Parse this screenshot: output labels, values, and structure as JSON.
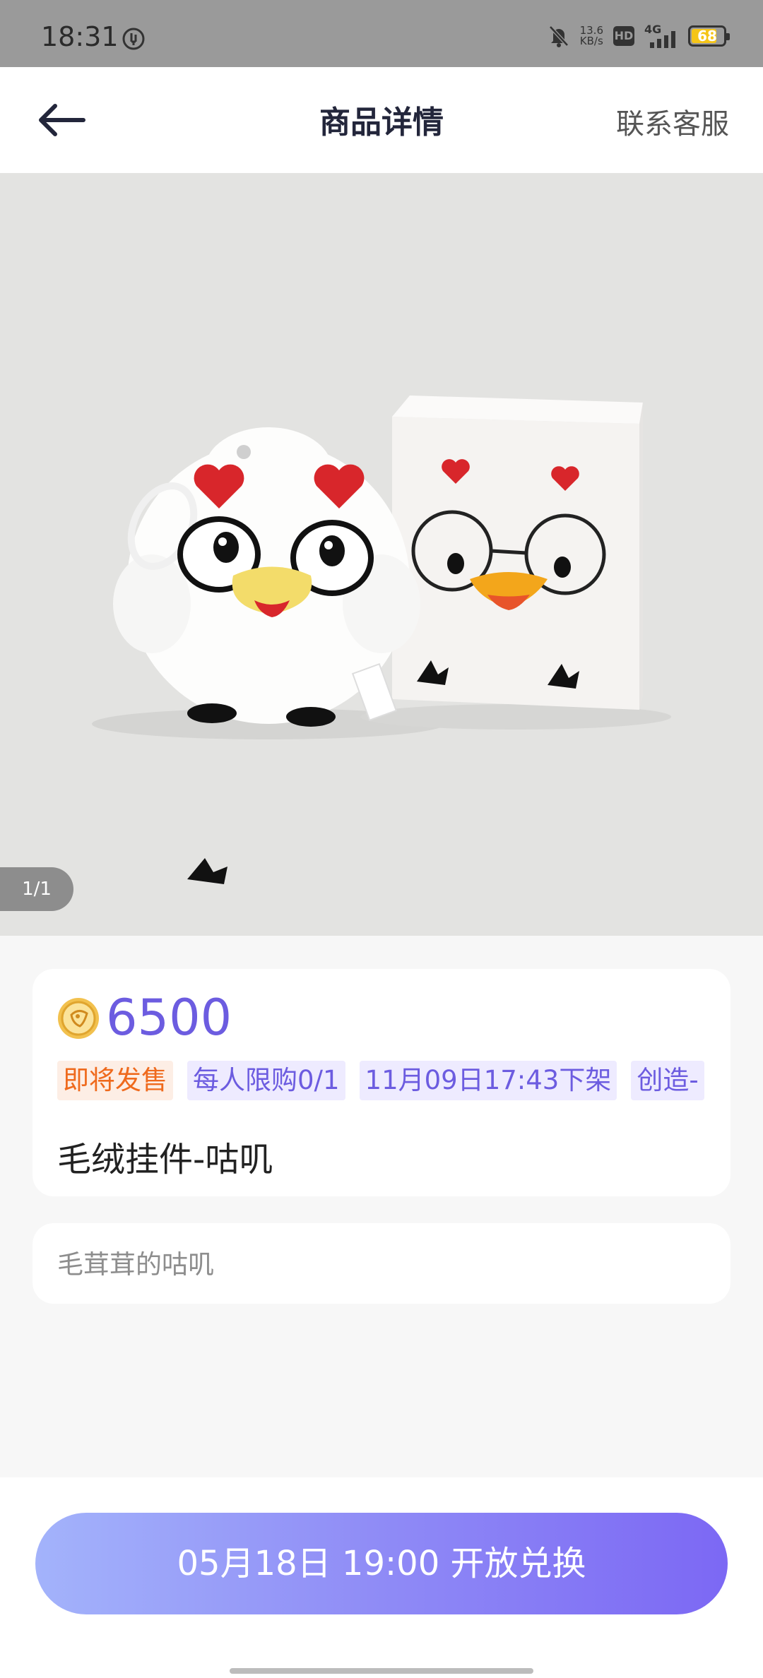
{
  "status_bar": {
    "time": "18:31",
    "net_speed_value": "13.6",
    "net_speed_unit": "KB/s",
    "hd_label": "HD",
    "network": "4G",
    "battery": "68",
    "icons": [
      "usb-icon",
      "mute-bell-icon",
      "signal-icon",
      "battery-icon"
    ]
  },
  "header": {
    "back_icon": "back-arrow-icon",
    "title": "商品详情",
    "service_label": "联系客服"
  },
  "gallery": {
    "pager": "1/1",
    "image_subject": "plush-chicken-keychain-with-box"
  },
  "product": {
    "coin_icon": "coin-icon",
    "price": "6500",
    "tags": [
      {
        "label": "即将发售",
        "style": "orange"
      },
      {
        "label": "每人限购0/1",
        "style": "purple"
      },
      {
        "label": "11月09日17:43下架",
        "style": "purple"
      },
      {
        "label": "创造-",
        "style": "purple"
      }
    ],
    "name": "毛绒挂件-咕叽",
    "description": "毛茸茸的咕叽"
  },
  "footer": {
    "cta_label": "05月18日 19:00 开放兑换"
  },
  "colors": {
    "accent": "#6c5ce0",
    "orange_tag": "#ef6a1d",
    "cta_start": "#a3b3fb",
    "cta_end": "#7c68f4"
  }
}
